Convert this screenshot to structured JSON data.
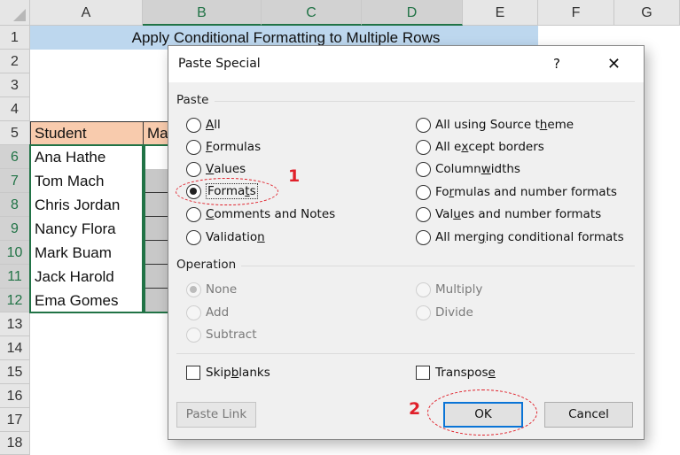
{
  "spreadsheet": {
    "columns": [
      "A",
      "B",
      "C",
      "D",
      "E",
      "F",
      "G"
    ],
    "selected_columns": [
      "B",
      "C",
      "D"
    ],
    "rows": [
      "1",
      "2",
      "3",
      "4",
      "5",
      "6",
      "7",
      "8",
      "9",
      "10",
      "11",
      "12",
      "13",
      "14",
      "15",
      "16",
      "17",
      "18"
    ],
    "selected_rows": [
      "6",
      "7",
      "8",
      "9",
      "10",
      "11",
      "12"
    ],
    "title": "Apply Conditional Formatting to Multiple Rows",
    "table_header": {
      "A": "Student",
      "B": "Ma"
    },
    "students": [
      "Ana Hathe",
      "Tom Mach",
      "Chris Jordan",
      "Nancy Flora",
      "Mark Buam",
      "Jack Harold",
      "Ema Gomes"
    ],
    "colors": {
      "title_fill": "#bdd7ee",
      "header_fill": "#f8cbad",
      "selection": "#217346"
    }
  },
  "dialog": {
    "title": "Paste Special",
    "help": "?",
    "close": "✕",
    "paste_group": "Paste",
    "paste_left": [
      {
        "pre": "",
        "key": "A",
        "post": "ll",
        "checked": false
      },
      {
        "pre": "",
        "key": "F",
        "post": "ormulas",
        "checked": false
      },
      {
        "pre": "",
        "key": "V",
        "post": "alues",
        "checked": false
      },
      {
        "pre": "Forma",
        "key": "t",
        "post": "s",
        "checked": true
      },
      {
        "pre": "",
        "key": "C",
        "post": "omments and Notes",
        "checked": false
      },
      {
        "pre": "Validatio",
        "key": "n",
        "post": "",
        "checked": false
      }
    ],
    "paste_right": [
      {
        "pre": "All using Source t",
        "key": "h",
        "post": "eme",
        "checked": false
      },
      {
        "pre": "All e",
        "key": "x",
        "post": "cept borders",
        "checked": false
      },
      {
        "pre": "Column ",
        "key": "w",
        "post": "idths",
        "checked": false
      },
      {
        "pre": "Fo",
        "key": "r",
        "post": "mulas and number formats",
        "checked": false
      },
      {
        "pre": "Val",
        "key": "u",
        "post": "es and number formats",
        "checked": false
      },
      {
        "pre": "All mer",
        "key": "g",
        "post": "ing conditional formats",
        "checked": false
      }
    ],
    "operation_group": "Operation",
    "operation_left": [
      {
        "label": "None",
        "checked": true
      },
      {
        "label": "Add",
        "checked": false
      },
      {
        "label": "Subtract",
        "checked": false
      }
    ],
    "operation_right": [
      {
        "label": "Multiply",
        "checked": false
      },
      {
        "label": "Divide",
        "checked": false
      }
    ],
    "skip_blanks": {
      "pre": "Skip ",
      "key": "b",
      "post": "lanks",
      "checked": false
    },
    "transpose": {
      "pre": "Transpos",
      "key": "e",
      "post": "",
      "checked": false
    },
    "paste_link": "Paste Link",
    "ok": "OK",
    "cancel": "Cancel"
  },
  "annotations": {
    "step1": "1",
    "step2": "2",
    "color": "#e0202a"
  }
}
